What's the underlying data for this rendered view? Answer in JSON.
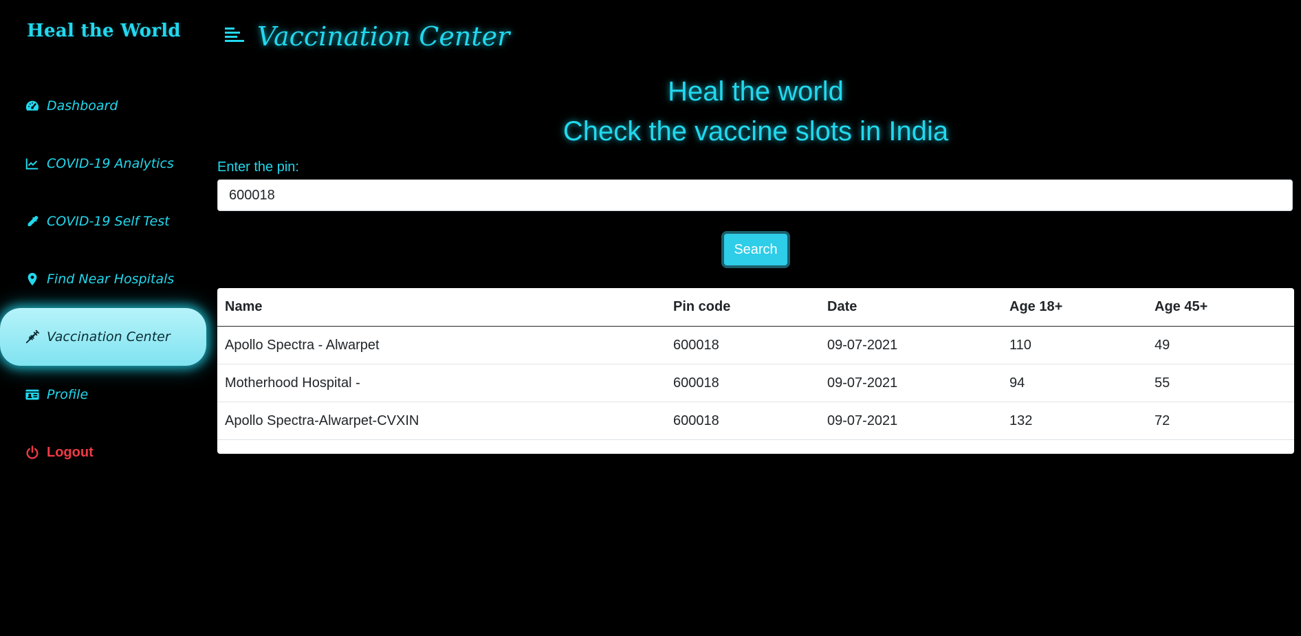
{
  "sidebar": {
    "brand": "Heal the World",
    "items": [
      {
        "label": "Dashboard",
        "icon": "dashboard-gauge-icon"
      },
      {
        "label": "COVID-19 Analytics",
        "icon": "line-chart-icon"
      },
      {
        "label": "COVID-19 Self Test",
        "icon": "eyedropper-icon"
      },
      {
        "label": "Find Near Hospitals",
        "icon": "map-marker-icon"
      },
      {
        "label": "Vaccination Center",
        "icon": "syringe-icon",
        "active": true
      },
      {
        "label": "Profile",
        "icon": "id-card-icon"
      }
    ],
    "logout": {
      "label": "Logout",
      "icon": "power-icon"
    }
  },
  "header": {
    "title": "Vaccination Center",
    "menu_icon": "menu-icon"
  },
  "hero": {
    "line1": "Heal the world",
    "line2": "Check the vaccine slots in India"
  },
  "search": {
    "label": "Enter the pin:",
    "value": "600018",
    "button": "Search"
  },
  "table": {
    "headers": [
      "Name",
      "Pin code",
      "Date",
      "Age 18+",
      "Age 45+"
    ],
    "rows": [
      [
        "Apollo Spectra - Alwarpet",
        "600018",
        "09-07-2021",
        "110",
        "49"
      ],
      [
        "Motherhood Hospital -",
        "600018",
        "09-07-2021",
        "94",
        "55"
      ],
      [
        "Apollo Spectra-Alwarpet-CVXIN",
        "600018",
        "09-07-2021",
        "132",
        "72"
      ]
    ]
  },
  "colors": {
    "accent": "#22d8ee",
    "background": "#000000",
    "logout": "#f03a45",
    "button": "#2ecde8"
  }
}
